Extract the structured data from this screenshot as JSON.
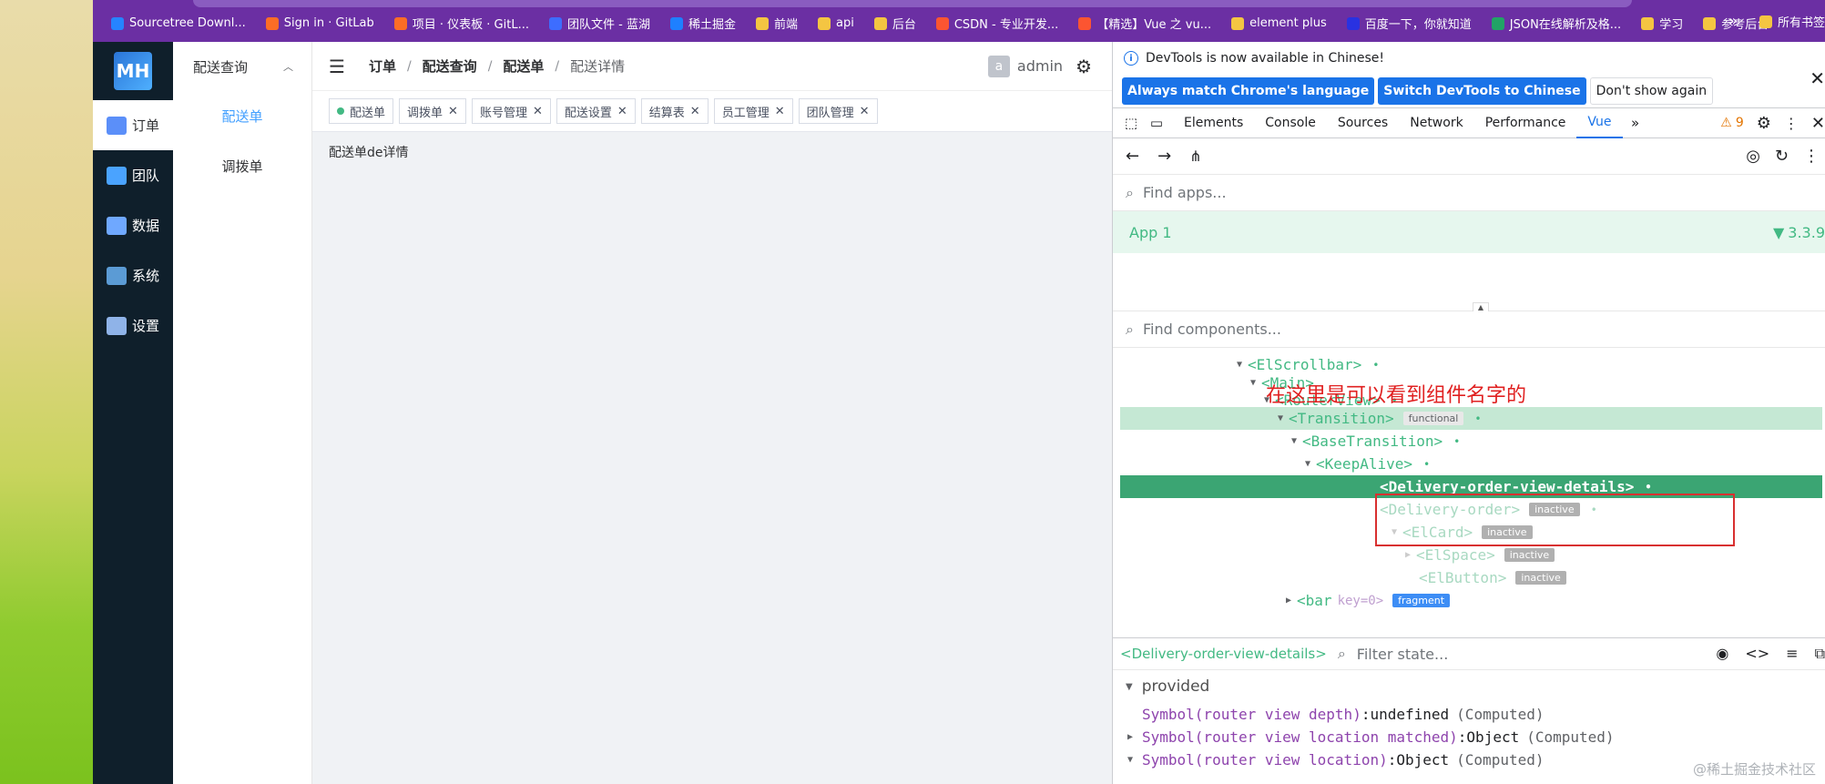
{
  "bookmarks": {
    "items": [
      {
        "label": "Sourcetree Downl...",
        "color": "#2684ff"
      },
      {
        "label": "Sign in · GitLab",
        "color": "#fc6d26"
      },
      {
        "label": "项目 · 仪表板 · GitL...",
        "color": "#fc6d26"
      },
      {
        "label": "团队文件 - 蓝湖",
        "color": "#3d6dff"
      },
      {
        "label": "稀土掘金",
        "color": "#1e80ff"
      },
      {
        "label": "前端",
        "color": "#f4c542"
      },
      {
        "label": "api",
        "color": "#f4c542"
      },
      {
        "label": "后台",
        "color": "#f4c542"
      },
      {
        "label": "CSDN - 专业开发...",
        "color": "#fc5531"
      },
      {
        "label": "【精选】Vue 之 vu...",
        "color": "#fc5531"
      },
      {
        "label": "element plus",
        "color": "#f4c542"
      },
      {
        "label": "百度一下，你就知道",
        "color": "#2932e1"
      },
      {
        "label": "JSON在线解析及格...",
        "color": "#21a366"
      },
      {
        "label": "学习",
        "color": "#f4c542"
      },
      {
        "label": "参考后台",
        "color": "#f4c542"
      }
    ],
    "more": "»",
    "all": "所有书签"
  },
  "app": {
    "logo_text": "MH",
    "nav": [
      {
        "label": "订单",
        "icon": "clipboard-icon",
        "color": "#5b8ff9",
        "active": true
      },
      {
        "label": "团队",
        "icon": "users-icon",
        "color": "#4aa3ff",
        "active": false
      },
      {
        "label": "数据",
        "icon": "chart-icon",
        "color": "#6fa8ff",
        "active": false
      },
      {
        "label": "系统",
        "icon": "monitor-icon",
        "color": "#5b9bd5",
        "active": false
      },
      {
        "label": "设置",
        "icon": "settings-icon",
        "color": "#8fb3e8",
        "active": false
      }
    ],
    "sub_nav": {
      "title": "配送查询",
      "items": [
        {
          "label": "配送单",
          "active": true
        },
        {
          "label": "调拨单",
          "active": false
        }
      ]
    },
    "breadcrumb": [
      "订单",
      "配送查询",
      "配送单",
      "配送详情"
    ],
    "user": {
      "avatar": "a",
      "name": "admin"
    },
    "tags": [
      {
        "label": "配送单",
        "active": true
      },
      {
        "label": "调拨单"
      },
      {
        "label": "账号管理"
      },
      {
        "label": "配送设置"
      },
      {
        "label": "结算表"
      },
      {
        "label": "员工管理"
      },
      {
        "label": "团队管理"
      }
    ],
    "content": "配送单de详情"
  },
  "devtools": {
    "info": "DevTools is now available in Chinese!",
    "btn_match": "Always match Chrome's language",
    "btn_switch": "Switch DevTools to Chinese",
    "btn_dont": "Don't show again",
    "tabs": [
      "Elements",
      "Console",
      "Sources",
      "Network",
      "Performance",
      "Vue"
    ],
    "active_tab": "Vue",
    "warnings": "9",
    "find_apps": "Find apps...",
    "app_name": "App 1",
    "vue_version": "3.3.9",
    "find_components": "Find components...",
    "annotation": "在这里是可以看到组件名字的",
    "tree": [
      {
        "tag": "<ElScrollbar>"
      },
      {
        "tag": "<Main>"
      },
      {
        "tag": "<RouterView>"
      },
      {
        "tag": "<Transition>",
        "badge": "functional"
      },
      {
        "tag": "<BaseTransition>"
      },
      {
        "tag": "<KeepAlive>"
      },
      {
        "tag": "<Delivery-order-view-details>"
      },
      {
        "tag": "<Delivery-order>",
        "badge": "inactive"
      },
      {
        "tag": "<ElCard>",
        "badge": "inactive"
      },
      {
        "tag": "<ElSpace>",
        "badge": "inactive"
      },
      {
        "tag": "<ElButton>",
        "badge": "inactive"
      },
      {
        "tag": "<bar",
        "key": "key=0>",
        "badge": "fragment"
      }
    ],
    "selected_component": "<Delivery-order-view-details>",
    "filter_state": "Filter state...",
    "provided": "provided",
    "symbols": [
      {
        "key": "Symbol(router view depth)",
        "val": "undefined",
        "meta": "(Computed)",
        "arrow": ""
      },
      {
        "key": "Symbol(router view location matched)",
        "val": "Object",
        "meta": "(Computed)",
        "arrow": "▶"
      },
      {
        "key": "Symbol(router view location)",
        "val": "Object",
        "meta": "(Computed)",
        "arrow": "▼"
      }
    ],
    "watermark": "@稀土掘金技术社区"
  }
}
